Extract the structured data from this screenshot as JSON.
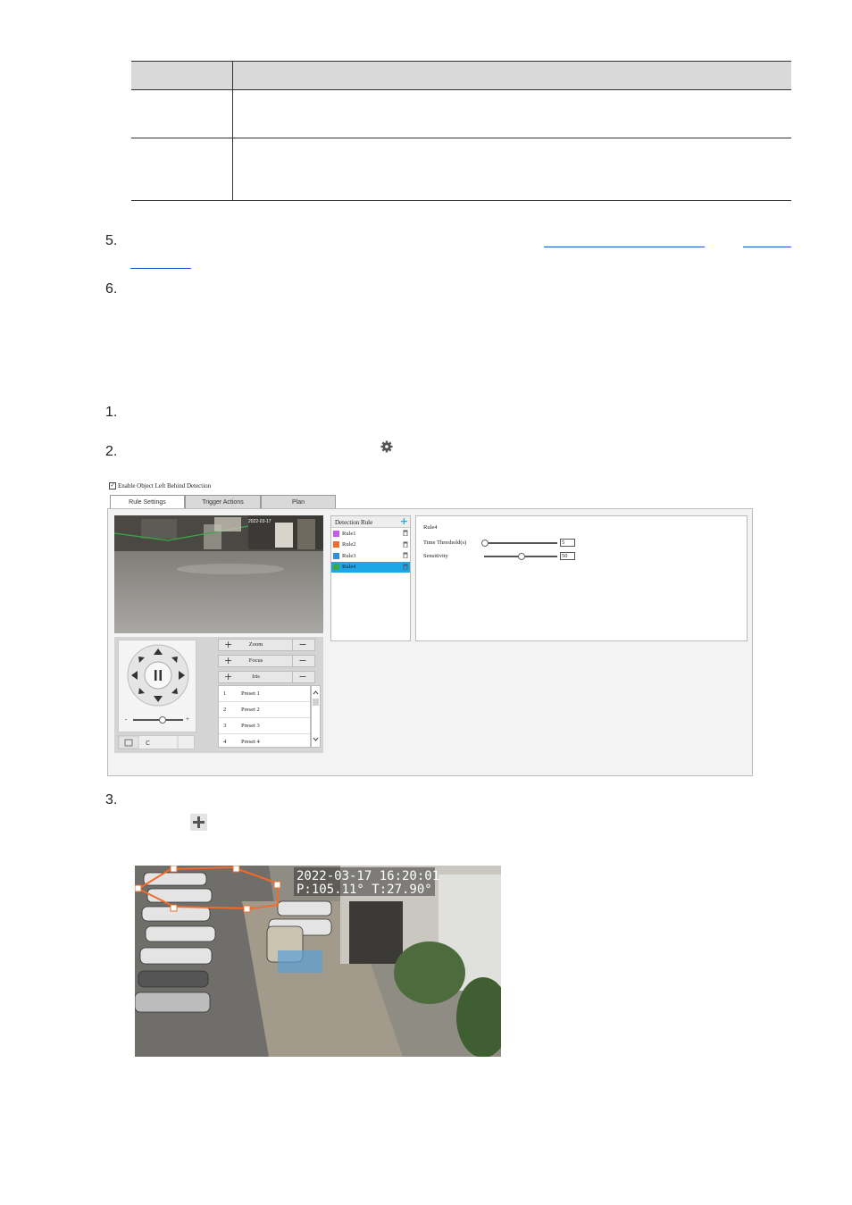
{
  "steps": [
    "5.",
    "6.",
    "1.",
    "2.",
    "3."
  ],
  "screenshot": {
    "enable_label": "Enable Object Left Behind Detection",
    "enable_checked": true,
    "tabs": [
      "Rule Settings",
      "Trigger Actions",
      "Plan"
    ],
    "active_tab": 0,
    "controls": [
      "Zoom",
      "Focus",
      "Iris"
    ],
    "presets": [
      {
        "num": "1",
        "name": "Preset 1"
      },
      {
        "num": "2",
        "name": "Preset 2"
      },
      {
        "num": "3",
        "name": "Preset 3"
      },
      {
        "num": "4",
        "name": "Preset 4"
      }
    ],
    "rules_header": "Detection Rule",
    "rules": [
      {
        "name": "Rule1",
        "color": "#c45cf0",
        "selected": false
      },
      {
        "name": "Rule2",
        "color": "#f26b2a",
        "selected": false
      },
      {
        "name": "Rule3",
        "color": "#2f8fe0",
        "selected": false
      },
      {
        "name": "Rule4",
        "color": "#3aa845",
        "selected": true
      }
    ],
    "selected_rule": "Rule4",
    "time_threshold_label": "Time Threshold(s)",
    "time_threshold": "5",
    "time_threshold_fraction": 0.0,
    "sensitivity_label": "Sensitivity",
    "sensitivity": "50",
    "sensitivity_fraction": 0.5,
    "speed_minus": "-",
    "speed_plus": "+",
    "video_overlay": "2022-03-17"
  },
  "photo2": {
    "timestamp": "2022-03-17  16:20:01",
    "position": "P:105.11°  T:27.90°"
  },
  "colors": {
    "link": "#1d4fd8",
    "header": "#d9d9d9",
    "selected": "#1ea7e8"
  }
}
